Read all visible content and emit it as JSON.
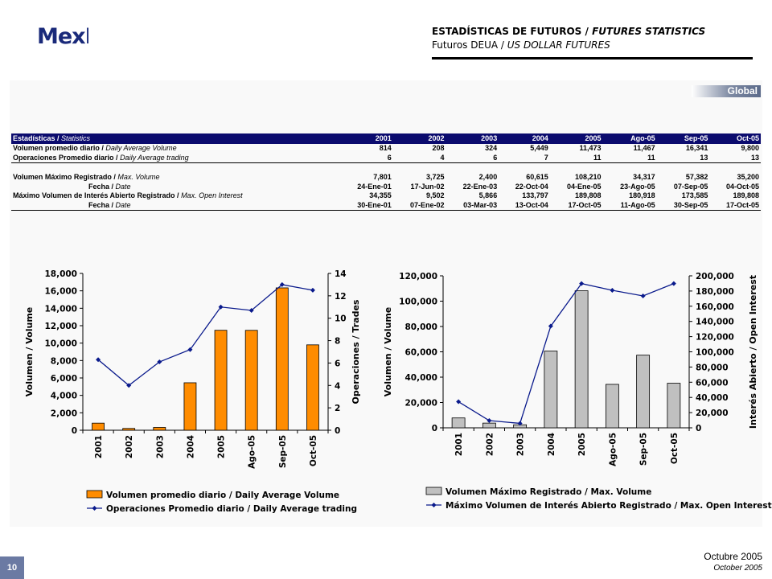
{
  "header": {
    "logo_text": "MexDer",
    "title_es": "ESTADÍSTICAS DE FUTUROS",
    "title_en": "FUTURES STATISTICS",
    "subtitle_es": "Futuros DEUA",
    "subtitle_en": "US DOLLAR FUTURES",
    "separator": " / "
  },
  "badge": "Global",
  "table": {
    "header_label_es": "Estadísticas",
    "header_label_en": "Statistics",
    "columns": [
      "2001",
      "2002",
      "2003",
      "2004",
      "2005",
      "Ago-05",
      "Sep-05",
      "Oct-05"
    ],
    "rows": [
      {
        "es": "Volumen promedio diario",
        "en": "Daily Average Volume",
        "values": [
          "814",
          "208",
          "324",
          "5,449",
          "11,473",
          "11,467",
          "16,341",
          "9,800"
        ]
      },
      {
        "es": "Operaciones Promedio diario",
        "en": "Daily Average trading",
        "values": [
          "6",
          "4",
          "6",
          "7",
          "11",
          "11",
          "13",
          "13"
        ]
      },
      {
        "es": "Volumen Máximo Registrado",
        "en": "Max. Volume",
        "values": [
          "7,801",
          "3,725",
          "2,400",
          "60,615",
          "108,210",
          "34,317",
          "57,382",
          "35,200"
        ]
      },
      {
        "es": "Fecha",
        "en": "Date",
        "values": [
          "24-Ene-01",
          "17-Jun-02",
          "22-Ene-03",
          "22-Oct-04",
          "04-Ene-05",
          "23-Ago-05",
          "07-Sep-05",
          "04-Oct-05"
        ]
      },
      {
        "es": "Máximo Volumen de Interés Abierto Registrado",
        "en": "Max. Open Interest",
        "values": [
          "34,355",
          "9,502",
          "5,866",
          "133,797",
          "189,808",
          "180,918",
          "173,585",
          "189,808"
        ]
      },
      {
        "es": "Fecha",
        "en": "Date",
        "values": [
          "30-Ene-01",
          "07-Ene-02",
          "03-Mar-03",
          "13-Oct-04",
          "17-Oct-05",
          "11-Ago-05",
          "30-Sep-05",
          "17-Oct-05"
        ]
      }
    ]
  },
  "chart_data": [
    {
      "type": "bar",
      "categories": [
        "2001",
        "2002",
        "2003",
        "2004",
        "2005",
        "Ago-05",
        "Sep-05",
        "Oct-05"
      ],
      "series": [
        {
          "name": "Volumen promedio diario / Daily Average Volume",
          "kind": "bar",
          "axis": "left",
          "color": "#ff8c00",
          "values": [
            814,
            208,
            324,
            5449,
            11473,
            11467,
            16341,
            9800
          ]
        },
        {
          "name": "Operaciones Promedio diario / Daily Average trading",
          "kind": "line",
          "axis": "right",
          "color": "#0a1a8c",
          "values": [
            6.3,
            4,
            6.1,
            7.2,
            11,
            10.7,
            13,
            12.5
          ]
        }
      ],
      "ylabel": "Volumen / Volume",
      "y2label": "Operaciones / Trades",
      "ylim": [
        0,
        18000
      ],
      "y_ticks": [
        "0",
        "2,000",
        "4,000",
        "6,000",
        "8,000",
        "10,000",
        "12,000",
        "14,000",
        "16,000",
        "18,000"
      ],
      "y2lim": [
        0,
        14
      ],
      "y2_ticks": [
        "0",
        "2",
        "4",
        "6",
        "8",
        "10",
        "12",
        "14"
      ],
      "legend_position": "bottom"
    },
    {
      "type": "bar",
      "categories": [
        "2001",
        "2002",
        "2003",
        "2004",
        "2005",
        "Ago-05",
        "Sep-05",
        "Oct-05"
      ],
      "series": [
        {
          "name": "Volumen Máximo Registrado / Max. Volume",
          "kind": "bar",
          "axis": "left",
          "color": "#c0c0c0",
          "values": [
            7801,
            3725,
            2400,
            60615,
            108210,
            34317,
            57382,
            35200
          ]
        },
        {
          "name": "Máximo Volumen de Interés Abierto Registrado / Max. Open Interest",
          "kind": "line",
          "axis": "right",
          "color": "#0a1a8c",
          "values": [
            34355,
            9502,
            5866,
            133797,
            189808,
            180918,
            173585,
            189808
          ]
        }
      ],
      "ylabel": "Volumen / Volume",
      "y2label": "Interés Abierto / Open Interest",
      "ylim": [
        0,
        120000
      ],
      "y_ticks": [
        "0",
        "20,000",
        "40,000",
        "60,000",
        "80,000",
        "100,000",
        "120,000"
      ],
      "y2lim": [
        0,
        200000
      ],
      "y2_ticks": [
        "0",
        "20,000",
        "40,000",
        "60,000",
        "80,000",
        "100,000",
        "120,000",
        "140,000",
        "160,000",
        "180,000",
        "200,000"
      ],
      "legend_position": "bottom"
    }
  ],
  "footer": {
    "page": "10",
    "month_es": "Octubre 2005",
    "month_en": "October 2005"
  }
}
